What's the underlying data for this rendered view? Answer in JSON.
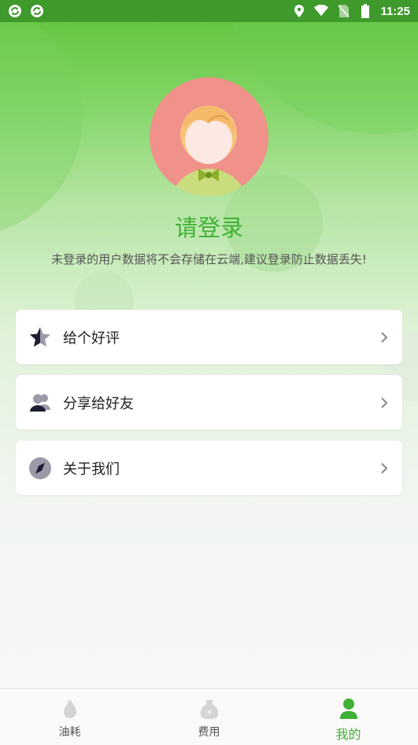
{
  "status_bar": {
    "time": "11:25",
    "left_icons": [
      "sync-icon",
      "sync-icon"
    ],
    "right_icons": [
      "location-icon",
      "wifi-icon",
      "no-sim-icon",
      "battery-icon"
    ]
  },
  "profile": {
    "title": "请登录",
    "subtitle": "未登录的用户数据将不会存储在云端,建议登录防止数据丢失!"
  },
  "menu": {
    "items": [
      {
        "label": "给个好评",
        "icon": "star-icon"
      },
      {
        "label": "分享给好友",
        "icon": "users-icon"
      },
      {
        "label": "关于我们",
        "icon": "compass-icon"
      }
    ]
  },
  "tabbar": {
    "tabs": [
      {
        "label": "油耗",
        "icon": "drop-icon",
        "active": false
      },
      {
        "label": "费用",
        "icon": "money-bag-icon",
        "active": false
      },
      {
        "label": "我的",
        "icon": "person-icon",
        "active": true
      }
    ]
  },
  "colors": {
    "accent": "#3fb136",
    "status_bar": "#3e9a2b",
    "avatar_bg": "#f0918a"
  }
}
